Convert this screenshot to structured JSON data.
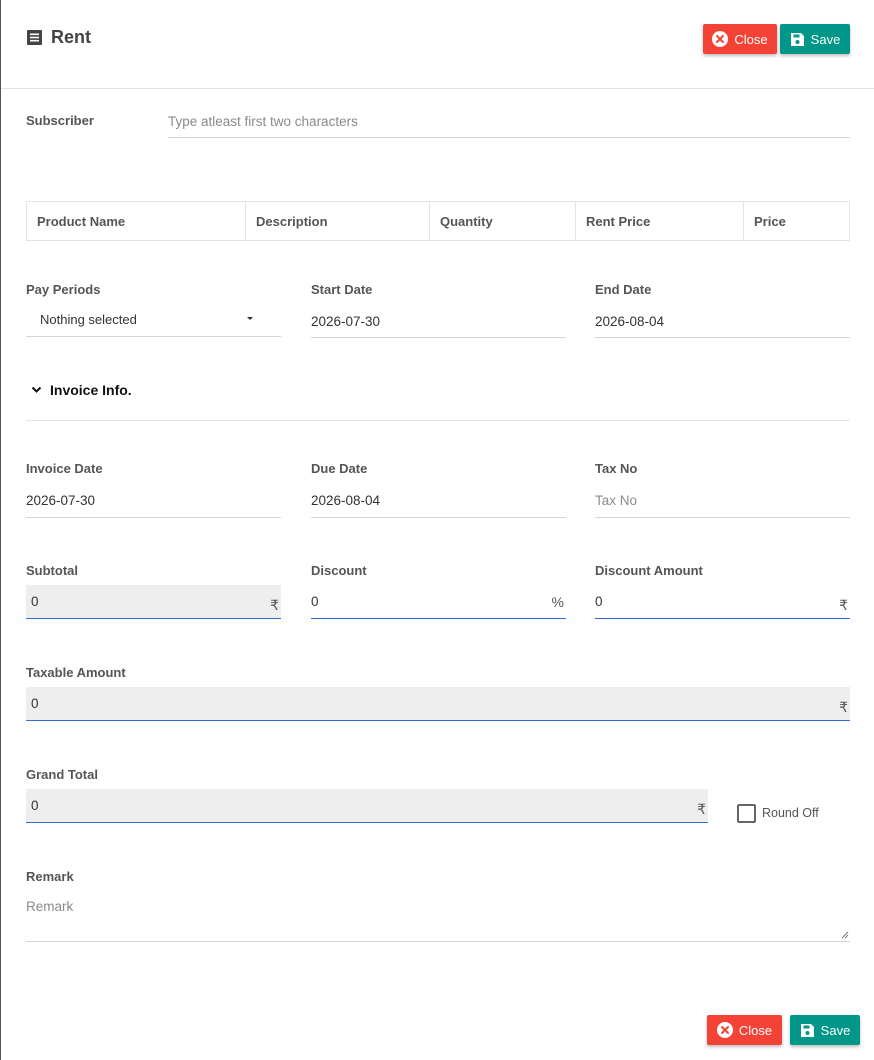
{
  "header": {
    "title": "Rent",
    "title_icon": "list-document-icon",
    "close_label": "Close",
    "save_label": "Save"
  },
  "subscriber": {
    "label": "Subscriber",
    "placeholder": "Type atleast first two characters"
  },
  "products_table": {
    "columns": [
      "Product Name",
      "Description",
      "Quantity",
      "Rent Price",
      "Price"
    ]
  },
  "pay_periods": {
    "label": "Pay Periods",
    "value": "Nothing selected"
  },
  "start_date": {
    "label": "Start Date",
    "value": "2026-07-30"
  },
  "end_date": {
    "label": "End Date",
    "value": "2026-08-04"
  },
  "invoice_section": {
    "title": "Invoice Info."
  },
  "invoice_date": {
    "label": "Invoice Date",
    "value": "2026-07-30"
  },
  "due_date": {
    "label": "Due Date",
    "value": "2026-08-04"
  },
  "tax_no": {
    "label": "Tax No",
    "placeholder": "Tax No"
  },
  "subtotal": {
    "label": "Subtotal",
    "value": "0",
    "suffix": "₹"
  },
  "discount": {
    "label": "Discount",
    "value": "0",
    "suffix": "%"
  },
  "discount_amount": {
    "label": "Discount Amount",
    "value": "0",
    "suffix": "₹"
  },
  "taxable_amount": {
    "label": "Taxable Amount",
    "value": "0",
    "suffix": "₹"
  },
  "grand_total": {
    "label": "Grand Total",
    "value": "0",
    "suffix": "₹"
  },
  "round_off": {
    "label": "Round Off",
    "checked": false
  },
  "remark": {
    "label": "Remark",
    "placeholder": "Remark"
  },
  "footer": {
    "close_label": "Close",
    "save_label": "Save"
  },
  "colors": {
    "close": "#f44336",
    "save": "#009688",
    "focus_line": "#2f6fd1"
  }
}
